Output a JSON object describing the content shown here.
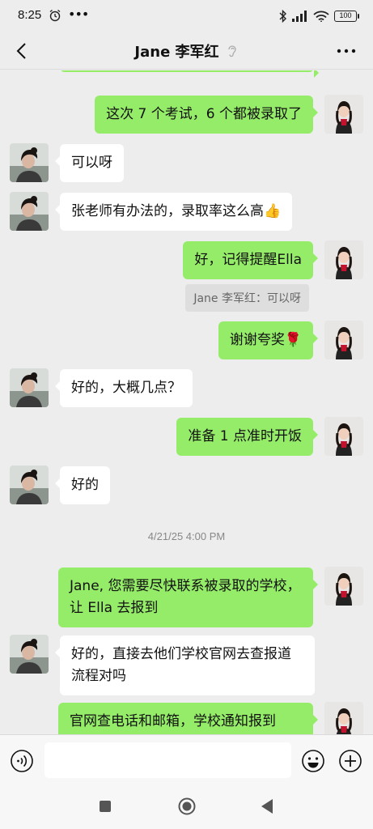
{
  "status_bar": {
    "time": "8:25",
    "battery": "100"
  },
  "header": {
    "title": "Jane 李军红"
  },
  "messages": [
    {
      "text": "这次 7 个考试，6 个都被录取了"
    },
    {
      "text": "可以呀"
    },
    {
      "text": "张老师有办法的，录取率这么高👍"
    },
    {
      "text": "好，记得提醒Ella"
    },
    {
      "text": "Jane 李军红：可以呀"
    },
    {
      "text": "谢谢夸奖🌹"
    },
    {
      "text": "好的，大概几点？"
    },
    {
      "text": "准备 1 点准时开饭"
    },
    {
      "text": "好的"
    },
    {
      "text": "4/21/25 4:00 PM"
    },
    {
      "text": "Jane, 您需要尽快联系被录取的学校，让 Ella 去报到"
    },
    {
      "text": "好的，直接去他们学校官网去查报道流程对吗"
    },
    {
      "text": "官网查电话和邮箱，学校通知报到"
    }
  ],
  "composer": {
    "input_value": ""
  },
  "colors": {
    "outgoing_bubble": "#95ec69",
    "incoming_bubble": "#ffffff",
    "background": "#ededed"
  },
  "icons": [
    "alarm-icon",
    "more-dots-icon",
    "bluetooth-icon",
    "signal-icon",
    "wifi-icon",
    "battery-icon",
    "back-arrow-icon",
    "mute-ear-icon",
    "more-icon",
    "voice-icon",
    "emoji-icon",
    "plus-icon",
    "recents-icon",
    "home-icon",
    "nav-back-icon"
  ]
}
